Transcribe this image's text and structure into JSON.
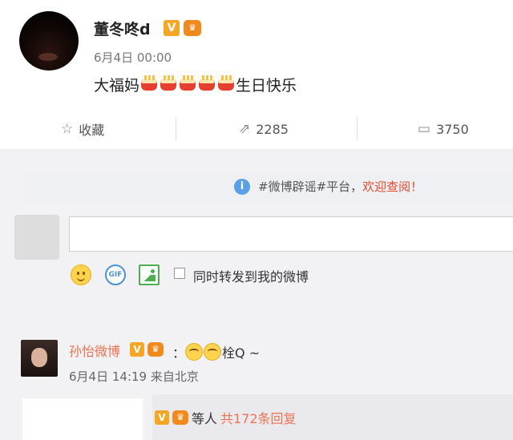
{
  "post": {
    "author": "董冬咚d",
    "timestamp": "6月4日 00:00",
    "text_before": "大福妈",
    "text_after": "生日快乐",
    "emoji_name": "cake-emoji",
    "emoji_count": 5
  },
  "actions": {
    "favorite_label": "收藏",
    "repost_count": "2285",
    "comment_count": "3750"
  },
  "notice": {
    "prefix": "#微博辟谣#平台，",
    "link": "欢迎查阅！"
  },
  "composer": {
    "input_value": "",
    "forward_label": "同时转发到我的微博",
    "gif_label": "GIF"
  },
  "comment": {
    "author": "孙怡微博",
    "text_suffix": "栓Q ~",
    "colon": "：",
    "meta": "6月4日 14:19 来自北京",
    "reply_label": "等人",
    "reply_count": "共172条回复"
  },
  "badges": {
    "v_label": "V",
    "crown_label": "♛"
  }
}
